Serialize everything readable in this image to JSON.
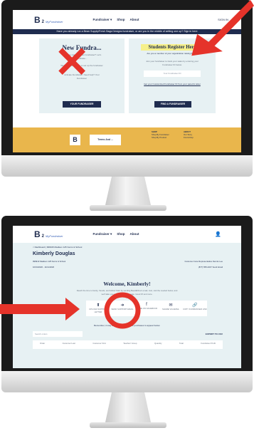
{
  "top_screen": {
    "site": {
      "logo": "B",
      "logo_sup": "2",
      "logo_sub": "MyFundraiser",
      "nav": [
        "Fundraiser ▾",
        "Shop",
        "About"
      ],
      "nav_right": "SIGN IN"
    },
    "banner_text": "Have you already run a Bean Supply/Fresh Bags Designs fundraiser, or are you in the middle of setting one up? Sign in here",
    "left_panel": {
      "heading": "New Fundra...",
      "line1": "Ready to start your own fundraiser? Let's",
      "line2": "fundraise...",
      "line3": "We'll need some info to set up the fundraiser",
      "line4": "Activate Fundraiser. Need help? Your",
      "line5": "Fundraiser",
      "button": "YOUR FUNDRAISER"
    },
    "right_panel": {
      "heading": "Students Register Here",
      "question": "Are you a member of your organization raising funds?",
      "line1": "Join your fundraiser to track your sales by entering your",
      "line2": "Fundraiser ID below.",
      "input_placeholder": "Your Fundraiser ID",
      "link": "Get your Customized Fundraiser ID from your parent's letter",
      "button": "FIND A FUNDRAISER"
    },
    "footer": {
      "logo": "B",
      "terms": "Terms And ...",
      "col1_title": "SHOP",
      "col1_items": [
        "Shop By Fundraiser",
        "Shop By Product"
      ],
      "col2_title": "ABOUT",
      "col2_items": [
        "Our Story",
        "Find A Rep"
      ]
    }
  },
  "bottom_screen": {
    "site": {
      "logo": "B",
      "logo_sup": "2",
      "logo_sub": "MyFundraiser",
      "nav": [
        "Fundraiser ▾",
        "Shop",
        "About"
      ]
    },
    "breadcrumb": "< Dashboard  |  999915 Madison 125 Kerns & School",
    "name": "Kimberly Douglas",
    "school": "999913 Madison 125 Kerns & School",
    "dates": "10/01/2020 - 11/11/2020",
    "rep_label": "Customer Care Representative Dennis Lee",
    "rep_phone": "(877) 555-2047 Send Email",
    "welcome": "Welcome, Kimberly!",
    "intro1": "Reach the time to family, friends, and fellow! Start by sending BeanEDirect email, Just, visit the needed below, and",
    "intro2": "we'll take you to your fundraiser page. Good Of and more.",
    "tiles": [
      {
        "icon": "⬆",
        "label": "UPLOAD SUPPORT LETTER"
      },
      {
        "icon": "➜",
        "label": "SEND SUPPORT EMAIL"
      },
      {
        "icon": "f",
        "label": "SHARE ON FACEBOOK"
      },
      {
        "icon": "✉",
        "label": "SHARE VIA EMAIL"
      },
      {
        "icon": "🔗",
        "label": "COPY FUNDRAISER LINK"
      }
    ],
    "reminder": "Remember, it may take a couple hours for purchases to appear below.",
    "search_placeholder": "Search orders",
    "export": "EXPORT TO CSV",
    "table_headers": [
      "Order",
      "Customer Last",
      "Customer First",
      "Teacher/ Group",
      "Quantity",
      "Total",
      "Fundraiser Profit"
    ]
  },
  "colors": {
    "navy": "#1f2c4f",
    "accent_red": "#e5332a",
    "panel_bg": "#e7f1f3",
    "footer_gold": "#e9b64c",
    "highlight": "#f6f08a"
  }
}
